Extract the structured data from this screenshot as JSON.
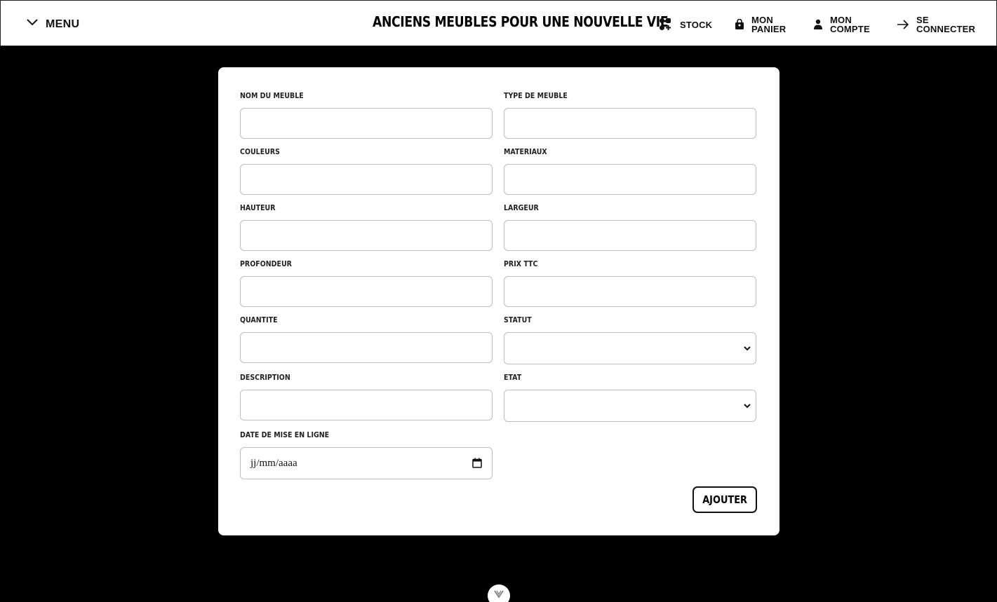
{
  "header": {
    "menu_label": "MENU",
    "brand_title": "ANCIENS MEUBLES POUR UNE NOUVELLE VIE",
    "nav": {
      "stock": "STOCK",
      "panier": "MON\nPANIER",
      "compte": "MON\nCOMPTE",
      "connect": "SE\nCONNECTER"
    }
  },
  "form": {
    "nom_du_meuble": {
      "label": "NOM DU MEUBLE",
      "value": ""
    },
    "type_de_meuble": {
      "label": "TYPE DE MEUBLE",
      "value": ""
    },
    "couleurs": {
      "label": "COULEURS",
      "value": ""
    },
    "materiaux": {
      "label": "MATERIAUX",
      "value": ""
    },
    "hauteur": {
      "label": "HAUTEUR",
      "value": ""
    },
    "largeur": {
      "label": "LARGEUR",
      "value": ""
    },
    "profondeur": {
      "label": "PROFONDEUR",
      "value": ""
    },
    "prix_ttc": {
      "label": "PRIX TTC",
      "value": ""
    },
    "quantite": {
      "label": "QUANTITE",
      "value": ""
    },
    "statut": {
      "label": "STATUT",
      "selected": ""
    },
    "description": {
      "label": "DESCRIPTION",
      "value": ""
    },
    "etat": {
      "label": "ETAT",
      "selected": ""
    },
    "date_mise_en_ligne": {
      "label": "DATE DE MISE EN LIGNE",
      "placeholder": "jj/mm/aaaa"
    },
    "submit_label": "AJOUTER"
  },
  "icons": {
    "menu": "chevron-down-icon",
    "stock": "grid-plus-icon",
    "panier": "shopping-bag-icon",
    "compte": "user-icon",
    "connect": "arrow-right-icon",
    "date": "calendar-icon",
    "scroll": "chevron-down-icon"
  },
  "colors": {
    "page_background": "#000000",
    "navbar_background": "#ffffff",
    "card_background": "#ffffff",
    "input_border": "#bfbfbf",
    "text": "#111111"
  }
}
